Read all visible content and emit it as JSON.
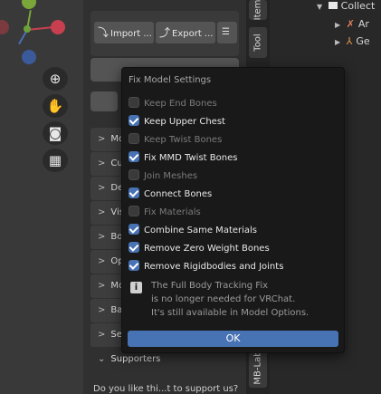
{
  "npanel": {
    "import_label": "Import ...",
    "export_label": "Export ...",
    "panels": [
      {
        "label": "Mod"
      },
      {
        "label": "Cust"
      },
      {
        "label": "Deci"
      },
      {
        "label": "Vise"
      },
      {
        "label": "Bone"
      },
      {
        "label": "Opti"
      },
      {
        "label": "Mod"
      },
      {
        "label": "Bake"
      },
      {
        "label": "Setti"
      },
      {
        "label": "Supporters"
      }
    ],
    "support_text": "Do you like thi...t to support us?"
  },
  "tabs": {
    "item": "Item",
    "tool": "Tool",
    "mblab": "MB-Lab"
  },
  "outliner": {
    "collection": "Collect",
    "row2": "Ar",
    "row3": "Ge"
  },
  "popup": {
    "title": "Fix Model Settings",
    "options": [
      {
        "label": "Keep End Bones",
        "checked": false
      },
      {
        "label": "Keep Upper Chest",
        "checked": true
      },
      {
        "label": "Keep Twist Bones",
        "checked": false
      },
      {
        "label": "Fix MMD Twist Bones",
        "checked": true
      },
      {
        "label": "Join Meshes",
        "checked": false
      },
      {
        "label": "Connect Bones",
        "checked": true
      },
      {
        "label": "Fix Materials",
        "checked": false
      },
      {
        "label": "Combine Same Materials",
        "checked": true
      },
      {
        "label": "Remove Zero Weight Bones",
        "checked": true
      },
      {
        "label": "Remove Rigidbodies and Joints",
        "checked": true
      }
    ],
    "info": [
      "The Full Body Tracking Fix",
      "is no longer needed for VRChat.",
      "It's still available in Model Options."
    ],
    "ok_label": "OK"
  }
}
